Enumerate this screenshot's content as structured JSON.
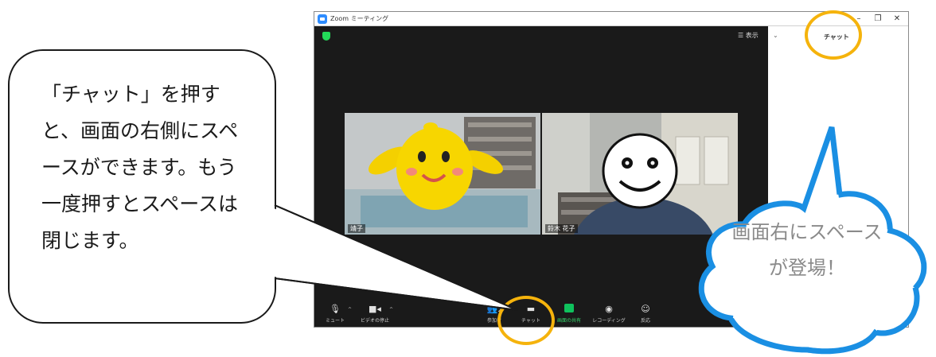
{
  "window": {
    "title": "Zoom ミーティング",
    "minimize": "–",
    "maximize": "❐",
    "close": "✕"
  },
  "meeting": {
    "view_label": "☰ 表示",
    "participants": [
      {
        "name": "靖子"
      },
      {
        "name": "鈴木 花子"
      }
    ]
  },
  "toolbar": {
    "mute": "ミュート",
    "stop_video": "ビデオの停止",
    "participants": "参加者",
    "participant_count": "2",
    "chat": "チャット",
    "share_screen": "画面の共有",
    "recording": "レコーディング",
    "reactions": "反応"
  },
  "chat_panel": {
    "title": "チャット"
  },
  "callout": {
    "text": "「チャット」を押すと、画面の右側にスペースができます。もう一度押すとスペースは閉じます。"
  },
  "thought": {
    "text": "画面右にスペースが登場！"
  },
  "colors": {
    "highlight": "#f5b30c",
    "thought_dots": "#1a8fe3",
    "share_green": "#0fc25d"
  }
}
